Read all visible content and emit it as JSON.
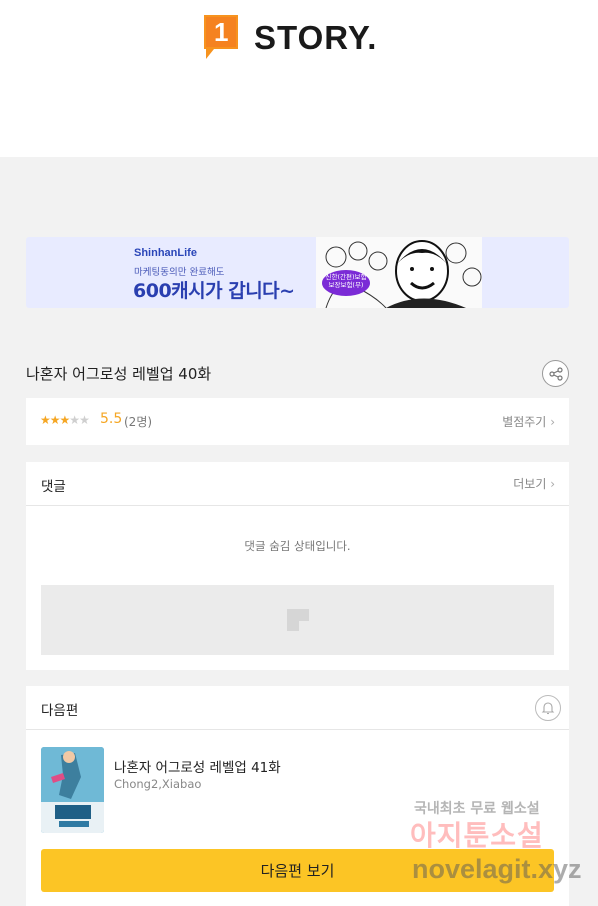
{
  "header": {
    "logo_number": "1",
    "logo_text": "STORY."
  },
  "banner": {
    "brand": "ShinhanLife",
    "subtitle": "마케팅동의만 완료해도",
    "headline": "600캐시가 갑니다~",
    "badge": "신한(간편)보험 보장보험(무)"
  },
  "episode": {
    "title": "나혼자 어그로성 레벨업 40화"
  },
  "rating": {
    "stars_filled": 3,
    "stars_total": 5,
    "score": "5.5",
    "count": "(2명)",
    "rate_link": "별점주기"
  },
  "comments": {
    "title": "댓글",
    "more_link": "더보기",
    "hidden_message": "댓글 숨김 상태입니다."
  },
  "next_episode": {
    "section_title": "다음편",
    "title": "나혼자 어그로성 레벨업 41화",
    "author": "Chong2,Xiabao",
    "button_label": "다음편 보기"
  },
  "watermark": {
    "line1": "국내최초 무료 웹소설",
    "line2": "아지툰소설",
    "line3": "novelagit.xyz"
  },
  "colors": {
    "brand_orange": "#f7931e",
    "accent_yellow": "#fcc525",
    "star": "#f5a623"
  }
}
